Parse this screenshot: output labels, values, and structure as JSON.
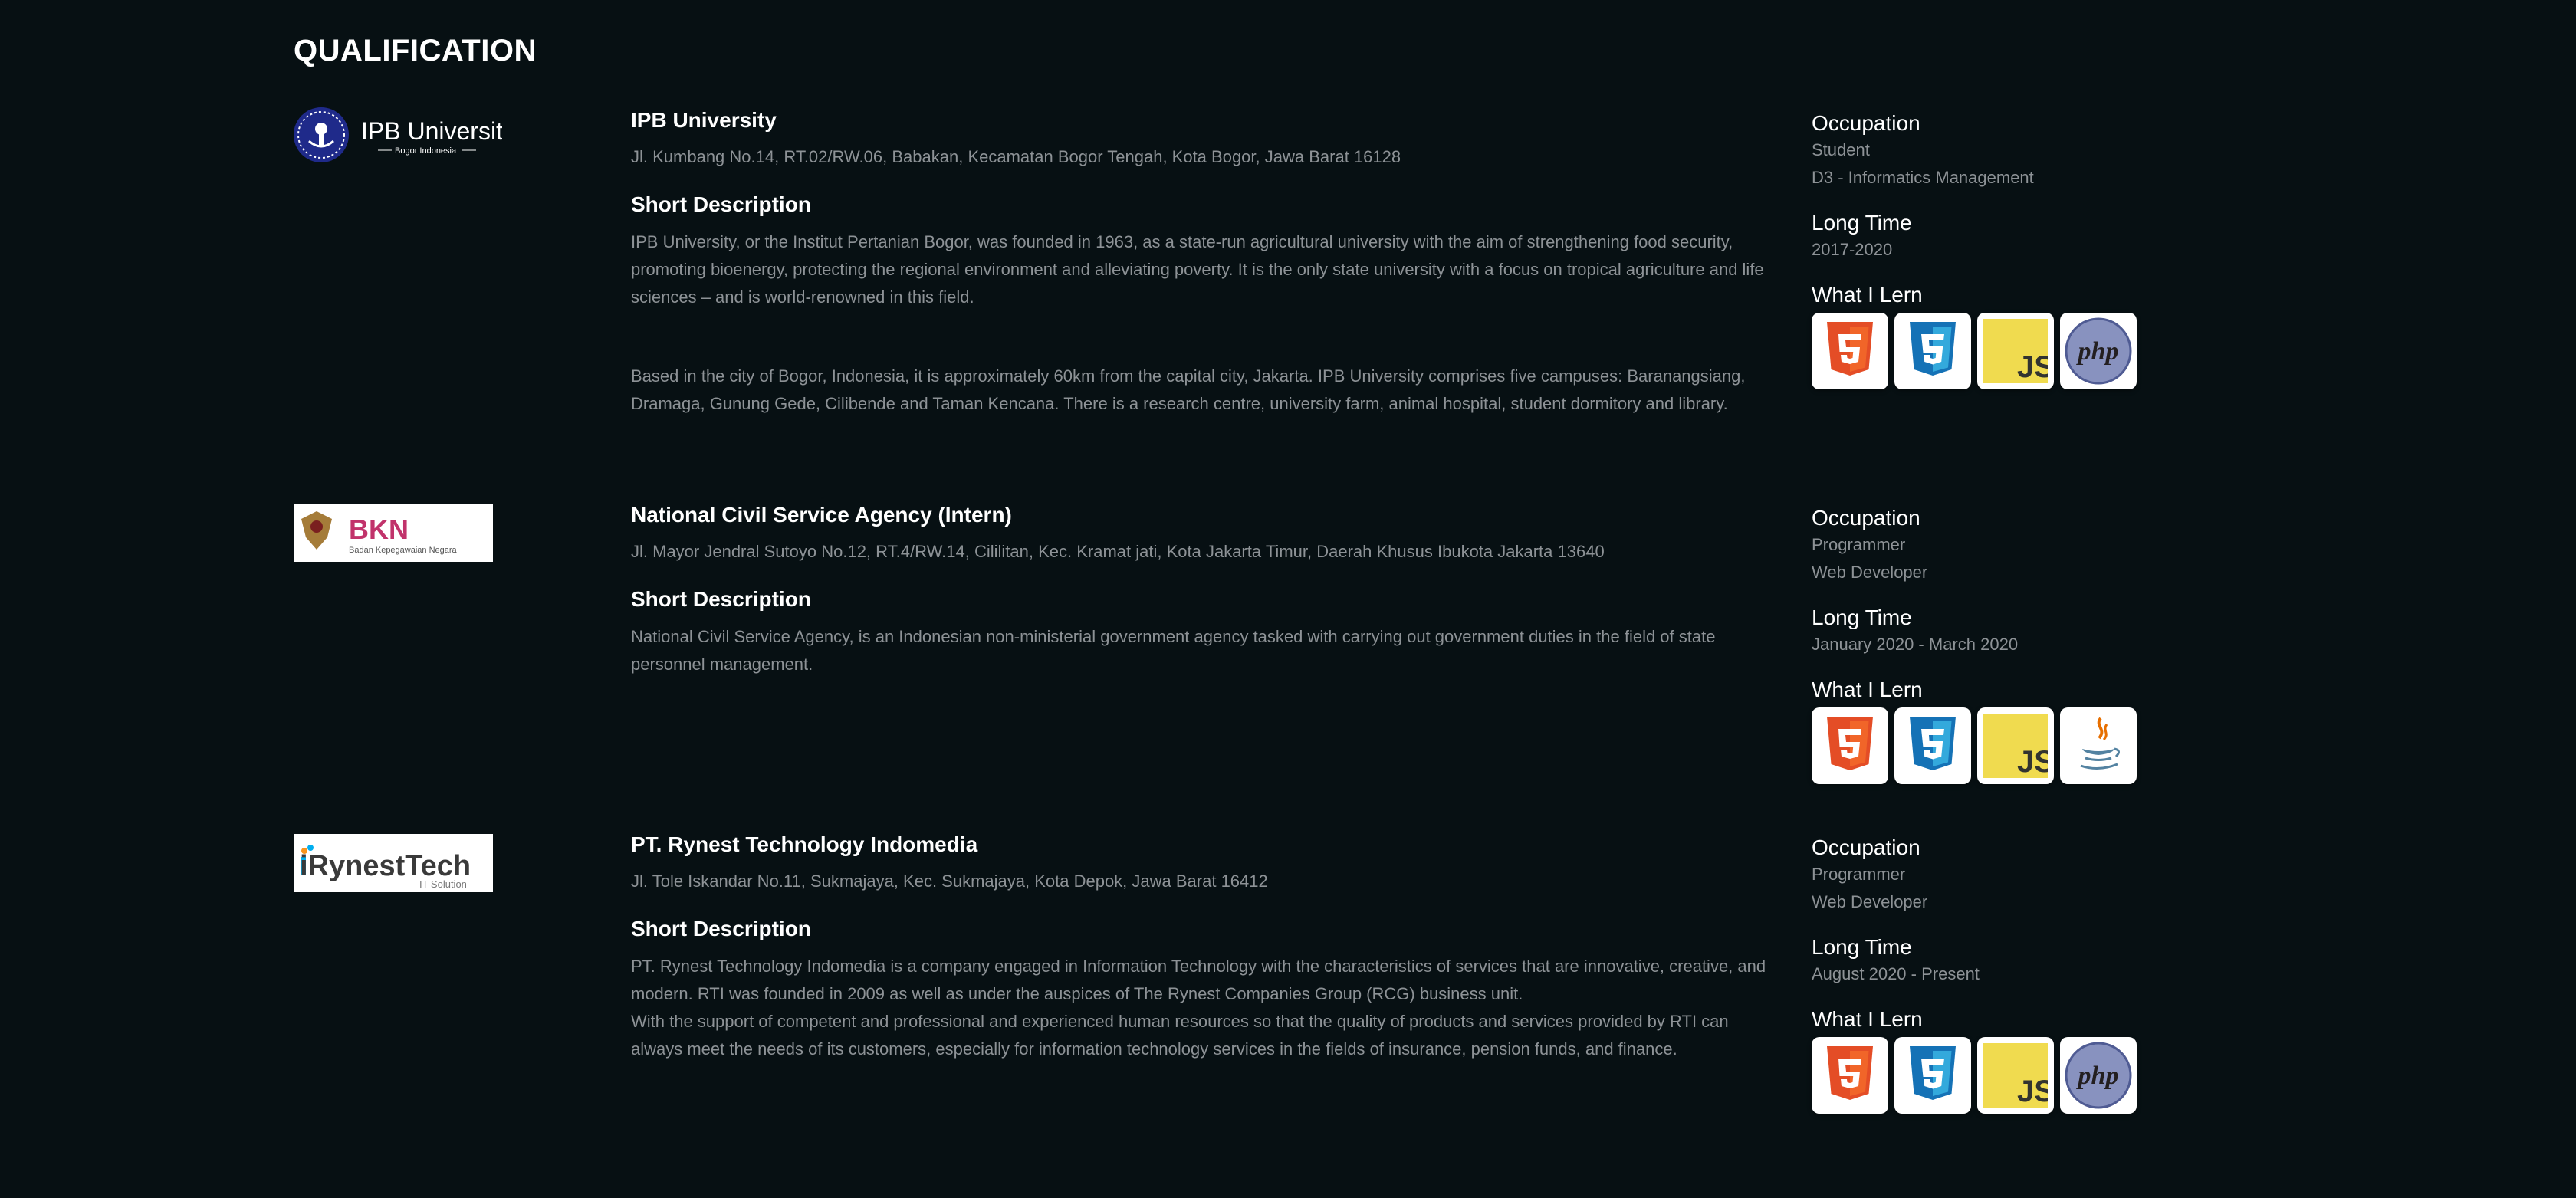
{
  "section_title": "QUALIFICATION",
  "labels": {
    "short_description": "Short Description",
    "occupation": "Occupation",
    "long_time": "Long Time",
    "what_i_learn": "What I Lern"
  },
  "entries": [
    {
      "logo_text": "IPB University",
      "logo_subtext": "Bogor Indonesia",
      "name": "IPB University",
      "address": "Jl. Kumbang No.14, RT.02/RW.06, Babakan, Kecamatan Bogor Tengah, Kota Bogor, Jawa Barat 16128",
      "description": [
        "IPB University, or the Institut Pertanian Bogor, was founded in 1963, as a state-run agricultural university with the aim of strengthening food security, promoting bioenergy, protecting the regional environment and alleviating poverty. It is the only state university with a focus on tropical agriculture and life sciences – and is world-renowned in this field.",
        "Based in the city of Bogor, Indonesia, it is approximately 60km from the capital city, Jakarta. IPB University comprises five campuses: Baranangsiang, Dramaga, Gunung Gede, Cilibende and Taman Kencana. There is a research centre, university farm, animal hospital, student dormitory and library."
      ],
      "occupation": [
        "Student",
        "D3 - Informatics Management"
      ],
      "long_time": "2017-2020",
      "skills": [
        "html5-icon",
        "css3-icon",
        "javascript-icon",
        "php-icon"
      ]
    },
    {
      "logo_text": "BKN",
      "logo_subtext": "Badan Kepegawaian Negara",
      "name": "National Civil Service Agency (Intern)",
      "address": "Jl. Mayor Jendral Sutoyo No.12, RT.4/RW.14, Cililitan, Kec. Kramat jati, Kota Jakarta Timur, Daerah Khusus Ibukota Jakarta 13640",
      "description": [
        "National Civil Service Agency, is an Indonesian non-ministerial government agency tasked with carrying out government duties in the field of state personnel management."
      ],
      "occupation": [
        "Programmer",
        "Web Developer"
      ],
      "long_time": "January 2020 - March 2020",
      "skills": [
        "html5-icon",
        "css3-icon",
        "javascript-icon",
        "java-icon"
      ]
    },
    {
      "logo_text": "iRynestTech",
      "logo_subtext": "IT Solution",
      "name": "PT. Rynest Technology Indomedia",
      "address": "Jl. Tole Iskandar No.11, Sukmajaya, Kec. Sukmajaya, Kota Depok, Jawa Barat 16412",
      "description": [
        "PT. Rynest Technology Indomedia is a company engaged in Information Technology with the characteristics of services that are innovative, creative, and modern. RTI was founded in 2009 as well as under the auspices of The Rynest Companies Group (RCG) business unit.",
        "With the support of competent and professional and experienced human resources so that the quality of products and services provided by RTI can always meet the needs of its customers, especially for information technology services in the fields of insurance, pension funds, and finance."
      ],
      "occupation": [
        "Programmer",
        "Web Developer"
      ],
      "long_time": "August 2020 - Present",
      "skills": [
        "html5-icon",
        "css3-icon",
        "javascript-icon",
        "php-icon"
      ]
    }
  ]
}
